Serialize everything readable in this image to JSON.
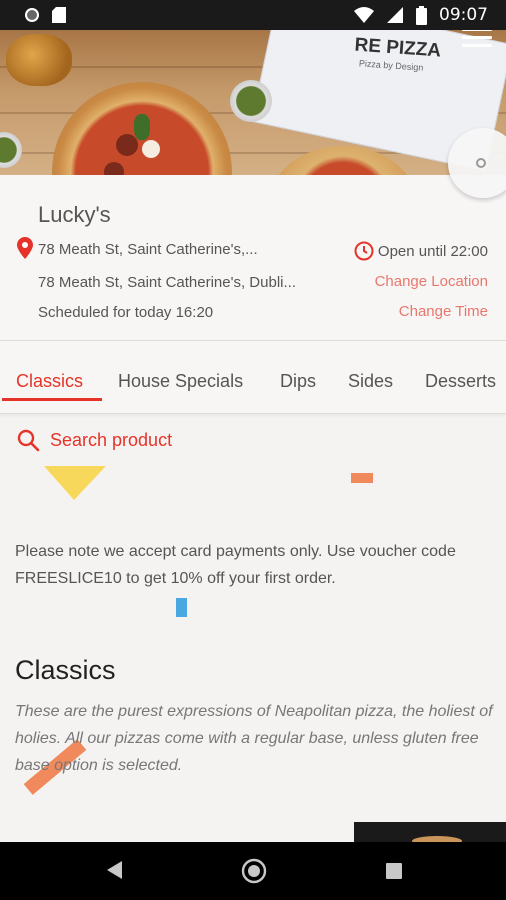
{
  "status_bar": {
    "time": "09:07"
  },
  "hero": {
    "box_logo": "RE PIZZA",
    "box_subtitle": "Pizza by Design"
  },
  "store": {
    "name": "Lucky's",
    "address_short": "78 Meath St, Saint Catherine's,...",
    "address_full": "78 Meath St, Saint Catherine's, Dubli...",
    "scheduled": "Scheduled for today 16:20",
    "open_status": "Open until 22:00",
    "change_location": "Change Location",
    "change_time": "Change Time"
  },
  "tabs": [
    {
      "label": "Classics",
      "active": true
    },
    {
      "label": "House Specials",
      "active": false
    },
    {
      "label": "Dips",
      "active": false
    },
    {
      "label": "Sides",
      "active": false
    },
    {
      "label": "Desserts",
      "active": false
    }
  ],
  "search": {
    "label": "Search product"
  },
  "notice": "Please note we accept card payments only. Use voucher code FREESLICE10 to get 10% off your first order.",
  "section": {
    "title": "Classics",
    "description": "These are the purest expressions of Neapolitan pizza, the holiest of holies. All our pizzas come with a regular base, unless gluten free base option is selected."
  },
  "colors": {
    "accent": "#e63329",
    "link": "#e8776d",
    "text": "#555555",
    "background": "#f5f3f1"
  },
  "icons": [
    "location-pin-icon",
    "clock-icon",
    "search-icon",
    "menu-icon",
    "camera-icon",
    "back-icon",
    "home-icon",
    "recents-icon"
  ]
}
